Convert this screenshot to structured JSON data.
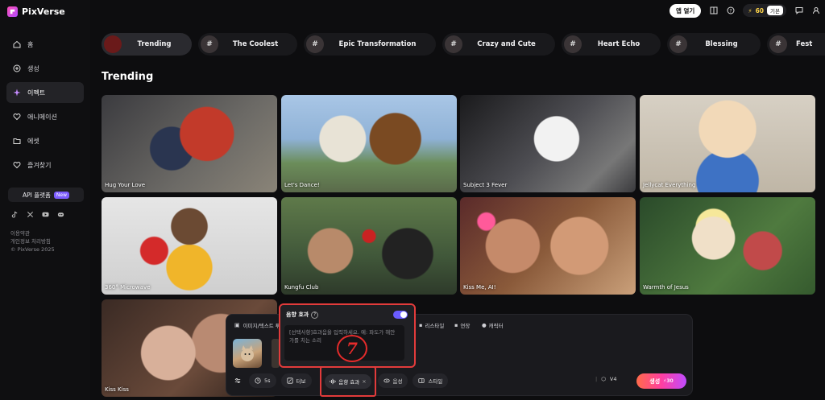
{
  "app": {
    "name": "PixVerse"
  },
  "header": {
    "app_open_label": "앱 열기",
    "credits": "60",
    "plan_label": "기본"
  },
  "sidebar": {
    "items": [
      {
        "label": "홈",
        "icon": "home-icon"
      },
      {
        "label": "생성",
        "icon": "plus-circle-icon"
      },
      {
        "label": "이펙트",
        "icon": "sparkle-icon",
        "active": true
      },
      {
        "label": "애니메이션",
        "icon": "heart-outline-icon"
      },
      {
        "label": "에셋",
        "icon": "folder-icon"
      },
      {
        "label": "즐겨찾기",
        "icon": "heart-icon"
      }
    ],
    "api_label": "API 플랫폼",
    "api_badge": "New",
    "socials": [
      "tiktok-icon",
      "x-icon",
      "youtube-icon",
      "discord-icon"
    ],
    "legal": [
      "이용약관",
      "개인정보 처리방침",
      "© PixVerse 2025"
    ]
  },
  "tabs": [
    {
      "label": "Trending",
      "active": true
    },
    {
      "label": "The Coolest"
    },
    {
      "label": "Epic Transformation"
    },
    {
      "label": "Crazy and Cute"
    },
    {
      "label": "Heart Echo"
    },
    {
      "label": "Blessing"
    },
    {
      "label": "Fest"
    }
  ],
  "section_title": "Trending",
  "cards": [
    {
      "caption": "Hug Your Love"
    },
    {
      "caption": "Let's Dance!"
    },
    {
      "caption": "Subject 3 Fever"
    },
    {
      "caption": "Jellycat Everything"
    },
    {
      "caption": "360° Microwave"
    },
    {
      "caption": "Kungfu Club"
    },
    {
      "caption": "Kiss Me, AI!"
    },
    {
      "caption": "Warmth of Jesus"
    },
    {
      "caption": "Kiss Kiss"
    }
  ],
  "panel": {
    "image_text_label": "이미지/텍스트 투",
    "restyle_label": "리스타일",
    "extend_label": "연장",
    "character_label": "캐릭터",
    "duration": "5s",
    "turbo_label": "터보",
    "sound_label": "음향 효과",
    "voice_label": "음성",
    "style_label": "스타일",
    "model": "V4",
    "generate_label": "생성",
    "generate_cost": "30"
  },
  "sound_popup": {
    "title": "음향 효과",
    "enabled": true,
    "placeholder": "[선택사항]효과음을 입력하세요. 예: 파도가 해안가를 치는 소리"
  },
  "annotation": {
    "step": "7"
  },
  "colors": {
    "accent": "#6a5cff",
    "highlight": "#e23b3b",
    "credit": "#ffd54a"
  }
}
